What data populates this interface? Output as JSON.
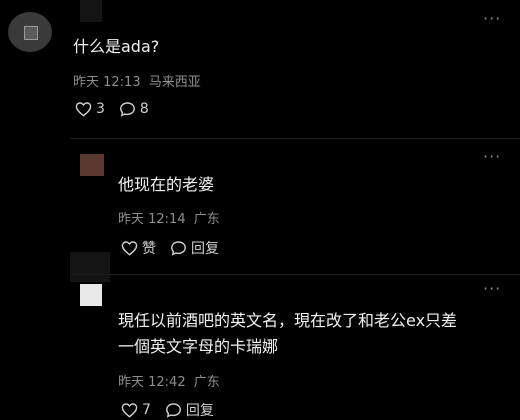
{
  "comments": [
    {
      "text": "什么是ada?",
      "time": "昨天 12:13",
      "location": "马来西亚",
      "likes": "3",
      "replies": "8",
      "more": "···"
    },
    {
      "text": "他现在的老婆",
      "time": "昨天 12:14",
      "location": "广东",
      "like_label": "赞",
      "reply_label": "回复",
      "more": "···"
    },
    {
      "text_line1": "現任以前酒吧的英文名，現在改了和老公ex只差",
      "text_line2": "一個英文字母的卡瑞娜",
      "time": "昨天 12:42",
      "location": "广东",
      "likes": "7",
      "reply_label": "回复",
      "more": "···"
    }
  ],
  "icons": {
    "heart": "heart-icon",
    "comment": "comment-icon",
    "more": "more-icon"
  },
  "colors": {
    "background": "#000000",
    "text": "#f2f2f2",
    "meta": "#8e8e8e"
  }
}
